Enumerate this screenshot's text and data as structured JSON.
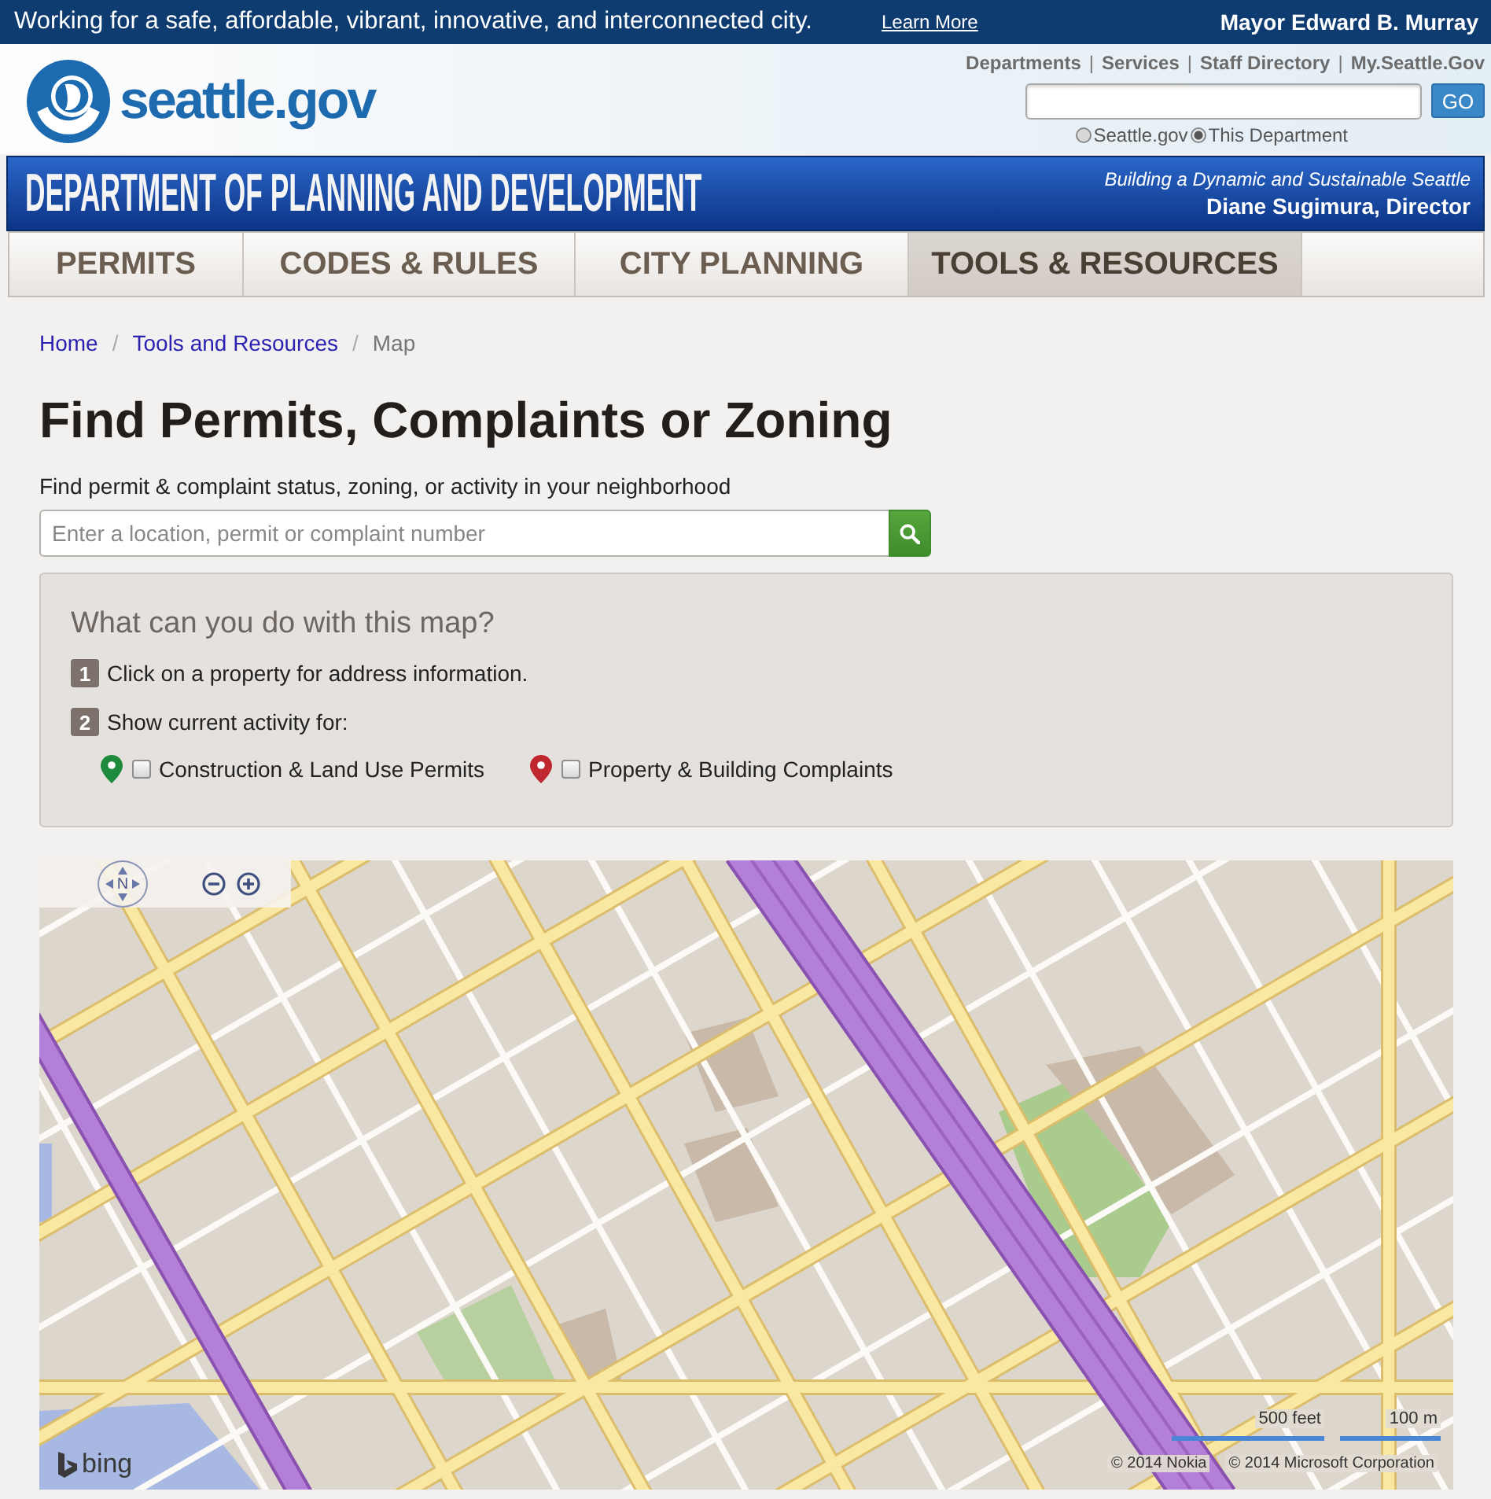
{
  "top_bar": {
    "slogan": "Working for a safe, affordable, vibrant, innovative, and interconnected city.",
    "link": "Learn More",
    "mayor": "Mayor Edward B. Murray"
  },
  "header": {
    "logo_text": "seattle.gov",
    "links": [
      {
        "kind": "link",
        "label": "Departments"
      },
      {
        "kind": "separator",
        "label": "|"
      },
      {
        "kind": "link",
        "label": "Services"
      },
      {
        "kind": "separator",
        "label": "|"
      },
      {
        "kind": "link",
        "label": "Staff Directory"
      },
      {
        "kind": "separator",
        "label": "|"
      },
      {
        "kind": "link",
        "label": "My.Seattle.Gov"
      }
    ],
    "search_button": "GO",
    "scopes": [
      {
        "label": "Seattle.gov",
        "selected": false
      },
      {
        "label": "This Department",
        "selected": true
      }
    ]
  },
  "department_banner": {
    "title": "DEPARTMENT OF PLANNING AND DEVELOPMENT",
    "tagline": "Building a Dynamic and Sustainable Seattle",
    "director": "Diane Sugimura, Director"
  },
  "nav_tabs": [
    {
      "label": "PERMITS",
      "selected": false
    },
    {
      "label": "CODES & RULES",
      "selected": false
    },
    {
      "label": "CITY PLANNING",
      "selected": false
    },
    {
      "label": "TOOLS & RESOURCES",
      "selected": true
    }
  ],
  "breadcrumb": [
    {
      "kind": "link",
      "label": "Home"
    },
    {
      "kind": "separator",
      "label": "/"
    },
    {
      "kind": "link",
      "label": "Tools and Resources"
    },
    {
      "kind": "separator",
      "label": "/"
    },
    {
      "kind": "current",
      "label": "Map"
    }
  ],
  "page_title": "Find Permits, Complaints or Zoning",
  "search": {
    "label": "Find permit & complaint status, zoning, or activity in your neighborhood",
    "placeholder": "Enter a location, permit or complaint number"
  },
  "info_box": {
    "heading": "What can you do with this map?",
    "steps": [
      {
        "number": "1",
        "text": "Click on a property for address information."
      },
      {
        "number": "2",
        "text": "Show current activity for:"
      }
    ],
    "layers": [
      {
        "label": "Construction & Land Use Permits",
        "color": "#1e8a3c",
        "checked": false
      },
      {
        "label": "Property & Building Complaints",
        "color": "#c0262e",
        "checked": false
      }
    ]
  },
  "map": {
    "compass": "N",
    "logo": "bing",
    "scale": [
      "500 feet",
      "100 m"
    ],
    "copyright": [
      "© 2014 Nokia",
      "© 2014 Microsoft Corporation"
    ]
  }
}
